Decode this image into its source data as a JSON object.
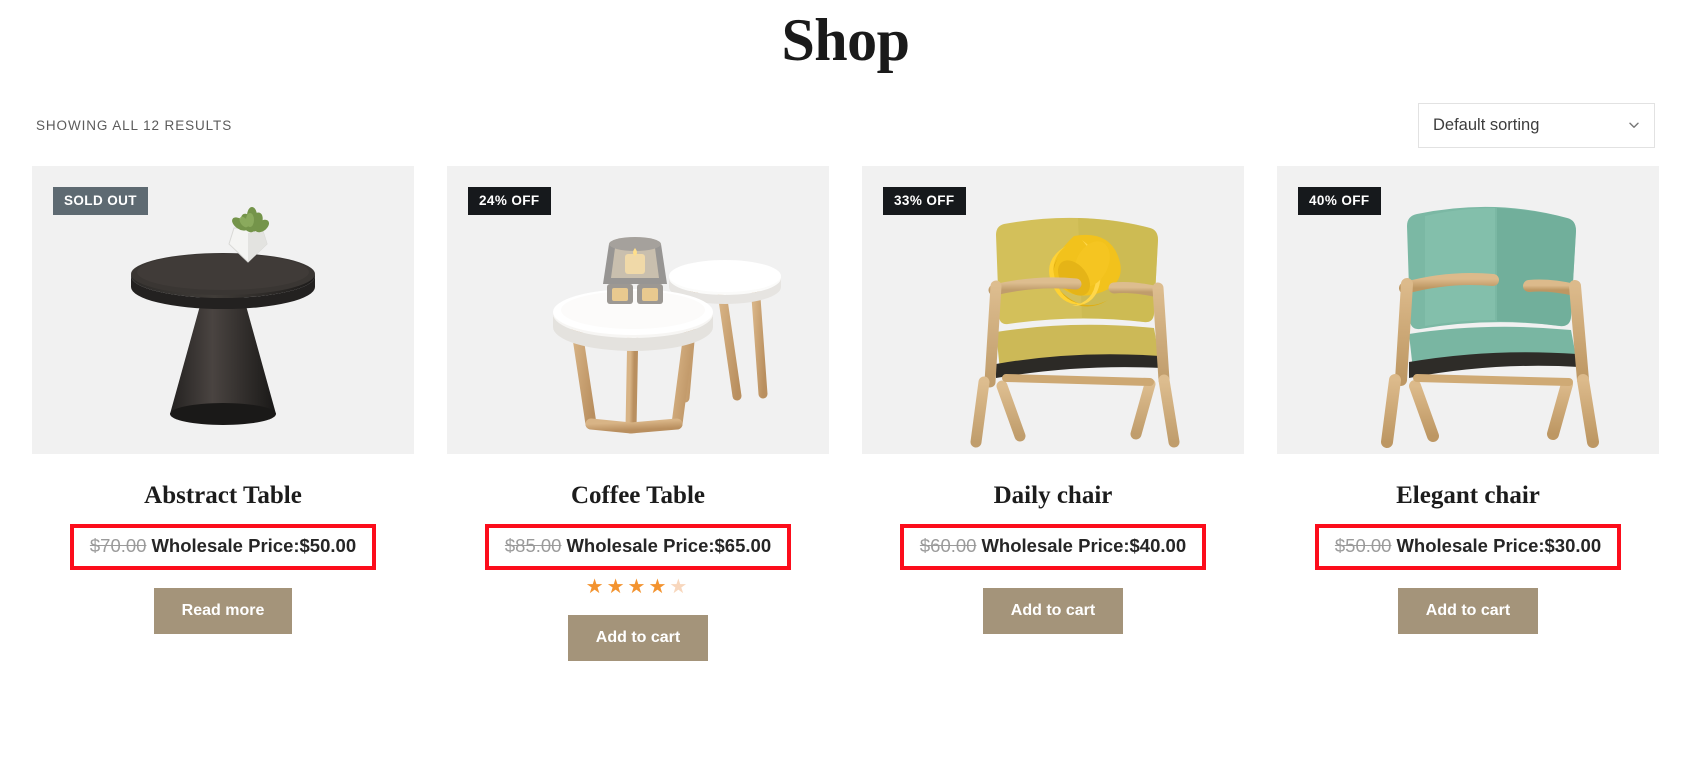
{
  "page": {
    "title": "Shop"
  },
  "toolbar": {
    "result_count": "SHOWING ALL 12 RESULTS",
    "sorting": {
      "selected": "Default sorting",
      "icon": "chevron-down-icon",
      "options": [
        "Default sorting"
      ]
    }
  },
  "colors": {
    "badge_sold_out_bg": "#5e6a72",
    "badge_discount_bg": "#16191c",
    "button_bg": "#a4947a",
    "highlight_border": "#fc0d1b",
    "star_on": "#f3932f",
    "star_off": "#f8d7bd",
    "thumb_bg": "#f1f1f1"
  },
  "products": [
    {
      "badge": "SOLD OUT",
      "badge_type": "sold-out",
      "title": "Abstract Table",
      "price_old": "$70.00",
      "price_new": "Wholesale Price:$50.00",
      "rating": null,
      "button": "Read more",
      "image_alt": "black-pedestal-table-with-plant"
    },
    {
      "badge": "24% OFF",
      "badge_type": "discount",
      "title": "Coffee Table",
      "price_old": "$85.00",
      "price_new": "Wholesale Price:$65.00",
      "rating": 4,
      "rating_max": 5,
      "button": "Add to cart",
      "image_alt": "white-round-nesting-coffee-tables"
    },
    {
      "badge": "33% OFF",
      "badge_type": "discount",
      "title": "Daily chair",
      "price_old": "$60.00",
      "price_new": "Wholesale Price:$40.00",
      "rating": null,
      "button": "Add to cart",
      "image_alt": "yellow-armchair-with-knot-cushion"
    },
    {
      "badge": "40% OFF",
      "badge_type": "discount",
      "title": "Elegant chair",
      "price_old": "$50.00",
      "price_new": "Wholesale Price:$30.00",
      "rating": null,
      "button": "Add to cart",
      "image_alt": "green-mid-century-armchair"
    }
  ]
}
